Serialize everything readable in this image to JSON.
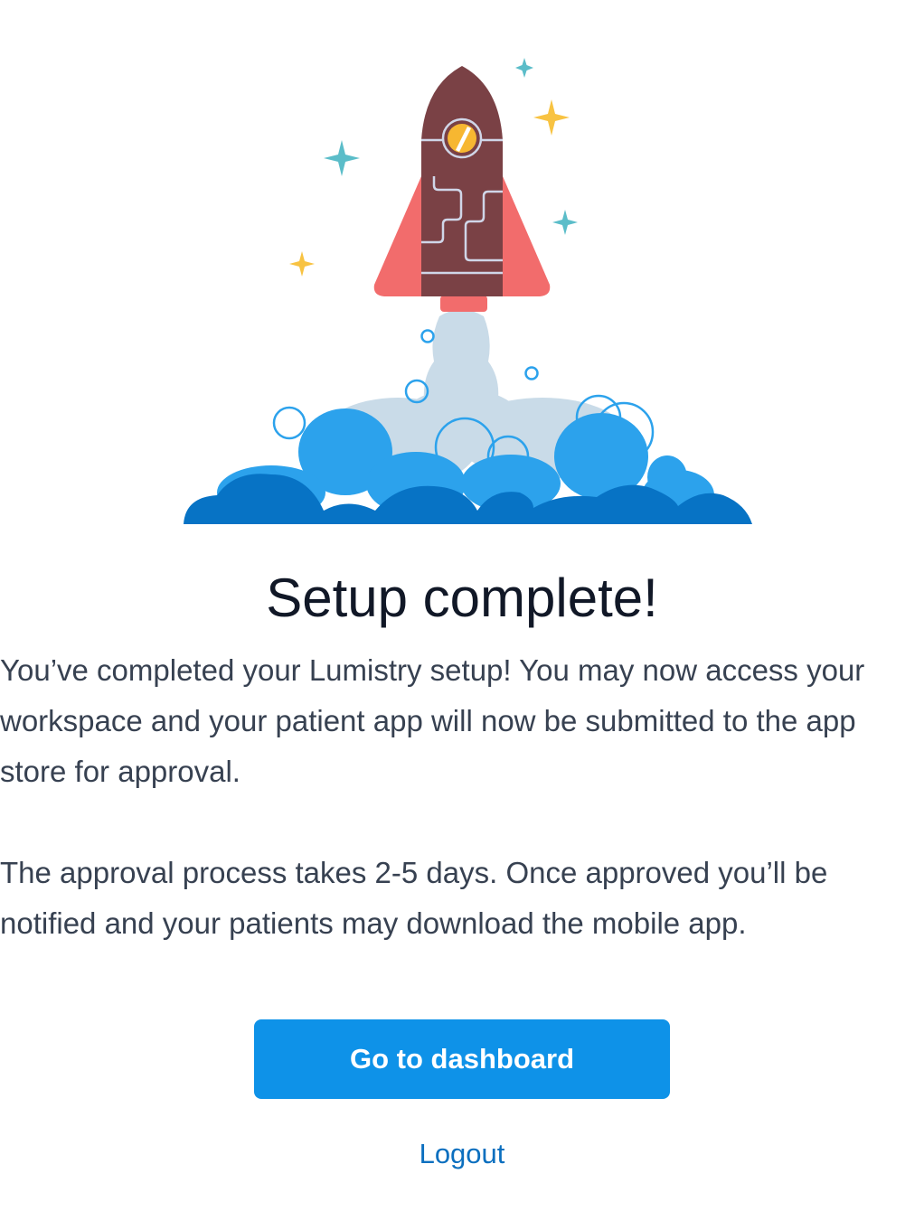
{
  "illustration": {
    "icon": "rocket-launch-icon",
    "colors": {
      "rocket_body": "#7a4145",
      "rocket_fins": "#f26c6c",
      "window_glass": "#f7b731",
      "cloud_dark": "#0773c5",
      "cloud_mid": "#2ca2ec",
      "smoke": "#c9dbe8",
      "star_teal": "#5bbdc9",
      "star_yellow": "#f8c342"
    }
  },
  "heading": "Setup complete!",
  "paragraphs": [
    "You’ve completed your Lumistry setup! You may now access your workspace and your patient app will now be submitted to the app store for approval.",
    "The approval process takes 2-5 days. Once approved you’ll be notified and your patients may download the mobile app."
  ],
  "actions": {
    "primary_label": "Go to dashboard",
    "secondary_label": "Logout"
  },
  "colors": {
    "primary": "#0e92e8",
    "link": "#0b6fbf",
    "heading": "#111827",
    "text": "#374151"
  }
}
